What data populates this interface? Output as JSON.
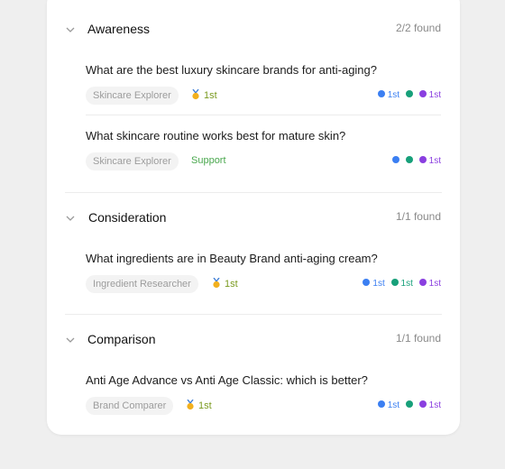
{
  "colors": {
    "blue": "#3b7ff2",
    "green": "#17a07a",
    "purple": "#8a3fe0",
    "rank": "#7a9a1e",
    "support": "#4aa84e"
  },
  "sections": [
    {
      "title": "Awareness",
      "count": "2/2 found",
      "questions": [
        {
          "text": "What are the best luxury skincare brands for anti-aging?",
          "persona": "Skincare Explorer",
          "badge": {
            "type": "rank",
            "icon": "medal-icon",
            "label": "1st"
          },
          "mentions": [
            {
              "color": "blue",
              "label": "1st"
            },
            {
              "color": "green",
              "label": ""
            },
            {
              "color": "purple",
              "label": "1st"
            }
          ]
        },
        {
          "text": "What skincare routine works best for mature skin?",
          "persona": "Skincare Explorer",
          "badge": {
            "type": "support",
            "label": "Support"
          },
          "mentions": [
            {
              "color": "blue",
              "label": ""
            },
            {
              "color": "green",
              "label": ""
            },
            {
              "color": "purple",
              "label": "1st"
            }
          ]
        }
      ]
    },
    {
      "title": "Consideration",
      "count": "1/1 found",
      "questions": [
        {
          "text": "What ingredients are in Beauty Brand anti-aging cream?",
          "persona": "Ingredient Researcher",
          "badge": {
            "type": "rank",
            "icon": "medal-icon",
            "label": "1st"
          },
          "mentions": [
            {
              "color": "blue",
              "label": "1st"
            },
            {
              "color": "green",
              "label": "1st"
            },
            {
              "color": "purple",
              "label": "1st"
            }
          ]
        }
      ]
    },
    {
      "title": "Comparison",
      "count": "1/1 found",
      "questions": [
        {
          "text": "Anti Age Advance vs Anti Age Classic: which is better?",
          "persona": "Brand Comparer",
          "badge": {
            "type": "rank",
            "icon": "medal-icon",
            "label": "1st"
          },
          "mentions": [
            {
              "color": "blue",
              "label": "1st"
            },
            {
              "color": "green",
              "label": ""
            },
            {
              "color": "purple",
              "label": "1st"
            }
          ]
        }
      ]
    }
  ]
}
